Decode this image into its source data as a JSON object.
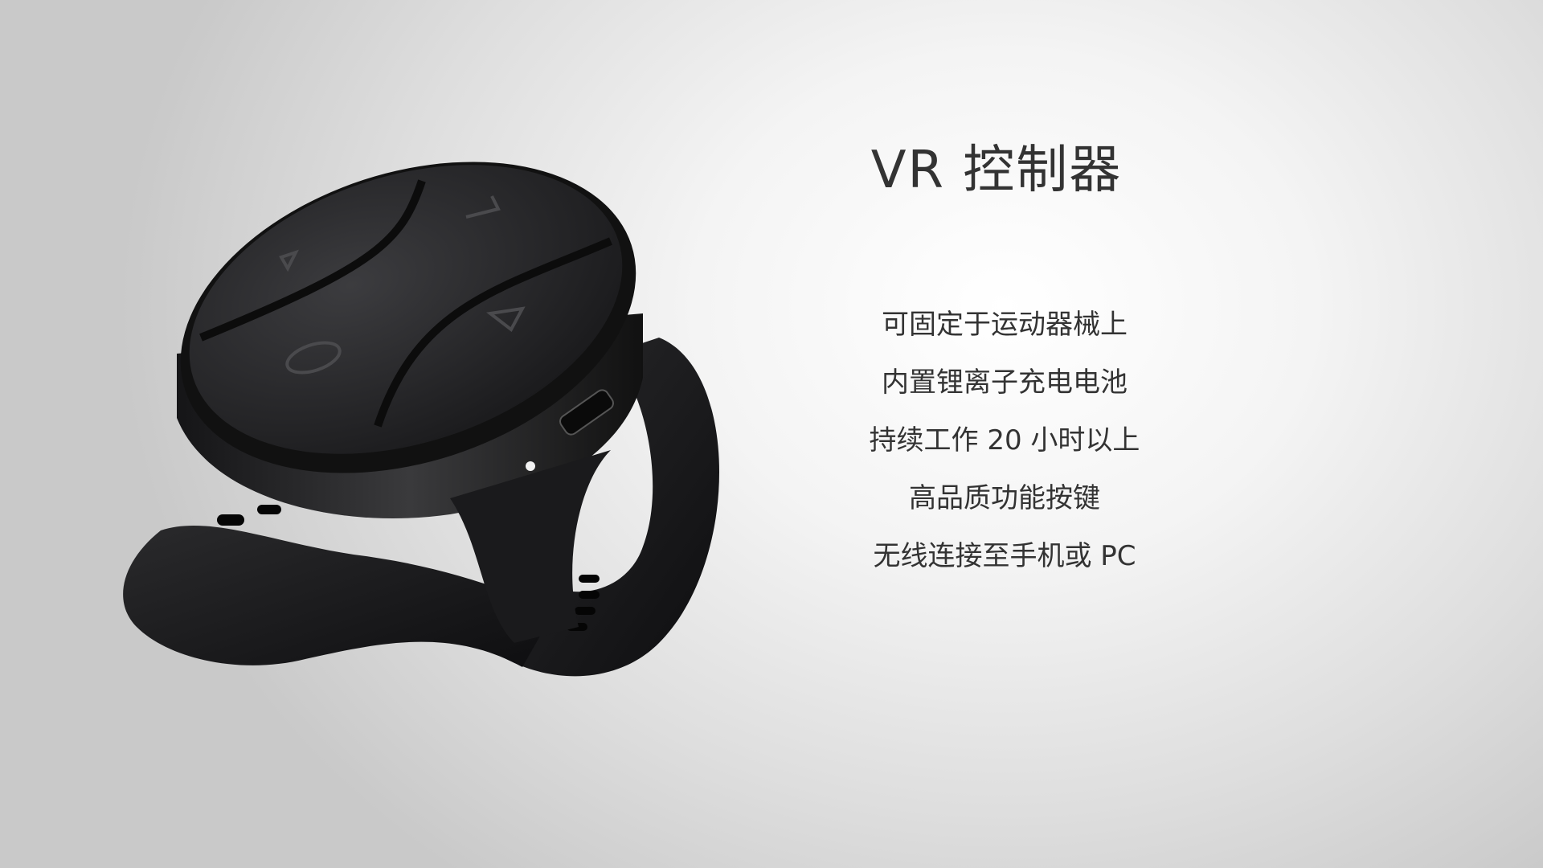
{
  "title": "VR 控制器",
  "features": [
    "可固定于运动器械上",
    "内置锂离子充电电池",
    "持续工作 20 小时以上",
    "高品质功能按键",
    "无线连接至手机或 PC"
  ],
  "colors": {
    "text": "#333333",
    "device": "#1c1c1e"
  }
}
